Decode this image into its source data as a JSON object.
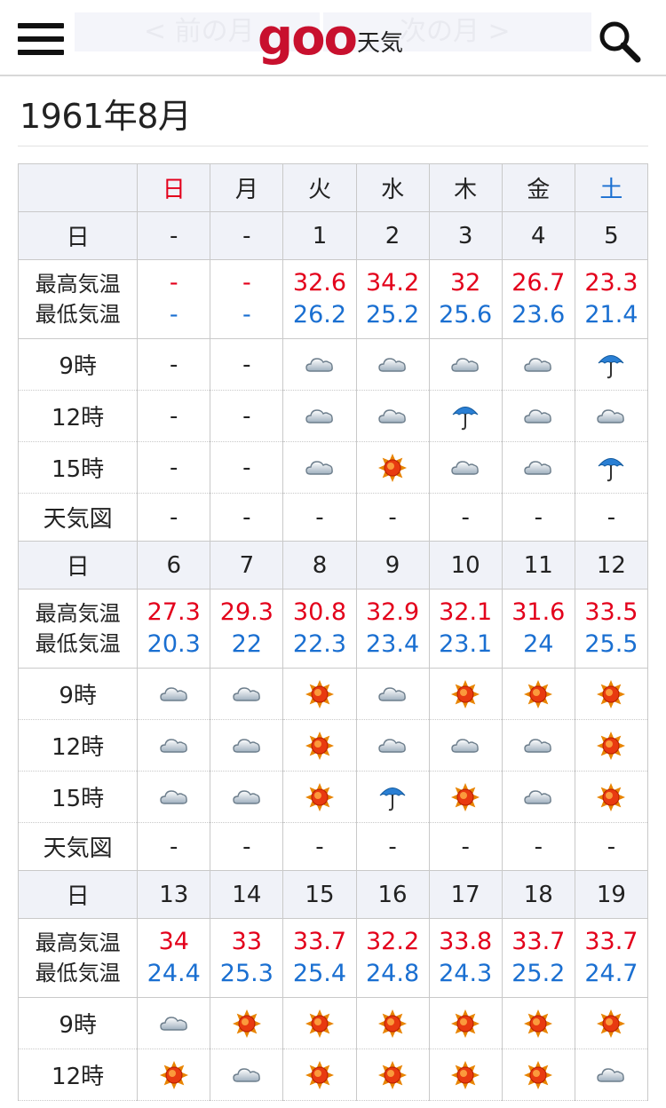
{
  "header": {
    "prev_label": "< 前の月",
    "next_label": "次の月 >",
    "logo_text": "goo",
    "logo_suffix": "天気"
  },
  "title": "1961年8月",
  "row_labels": {
    "day": "日",
    "hilo_hi": "最高気温",
    "hilo_lo": "最低気温",
    "t9": "9時",
    "t12": "12時",
    "t15": "15時",
    "map": "天気図"
  },
  "weekdays": [
    "日",
    "月",
    "火",
    "水",
    "木",
    "金",
    "土"
  ],
  "colors": {
    "high": "#e3001b",
    "low": "#1a6fd1",
    "header_bg": "#f0f2f8"
  },
  "weeks": [
    {
      "days": [
        "-",
        "-",
        "1",
        "2",
        "3",
        "4",
        "5"
      ],
      "hi": [
        "-",
        "-",
        "32.6",
        "34.2",
        "32",
        "26.7",
        "23.3"
      ],
      "lo": [
        "-",
        "-",
        "26.2",
        "25.2",
        "25.6",
        "23.6",
        "21.4"
      ],
      "t9": [
        "-",
        "-",
        "cloud-icon",
        "cloud-icon",
        "cloud-icon",
        "cloud-icon",
        "umbrella-icon"
      ],
      "t12": [
        "-",
        "-",
        "cloud-icon",
        "cloud-icon",
        "umbrella-icon",
        "cloud-icon",
        "cloud-icon"
      ],
      "t15": [
        "-",
        "-",
        "cloud-icon",
        "sun-icon",
        "cloud-icon",
        "cloud-icon",
        "umbrella-icon"
      ],
      "map": [
        "-",
        "-",
        "-",
        "-",
        "-",
        "-",
        "-"
      ]
    },
    {
      "days": [
        "6",
        "7",
        "8",
        "9",
        "10",
        "11",
        "12"
      ],
      "hi": [
        "27.3",
        "29.3",
        "30.8",
        "32.9",
        "32.1",
        "31.6",
        "33.5"
      ],
      "lo": [
        "20.3",
        "22",
        "22.3",
        "23.4",
        "23.1",
        "24",
        "25.5"
      ],
      "t9": [
        "cloud-icon",
        "cloud-icon",
        "sun-icon",
        "cloud-icon",
        "sun-icon",
        "sun-icon",
        "sun-icon"
      ],
      "t12": [
        "cloud-icon",
        "cloud-icon",
        "sun-icon",
        "cloud-icon",
        "cloud-icon",
        "cloud-icon",
        "sun-icon"
      ],
      "t15": [
        "cloud-icon",
        "cloud-icon",
        "sun-icon",
        "umbrella-icon",
        "sun-icon",
        "cloud-icon",
        "sun-icon"
      ],
      "map": [
        "-",
        "-",
        "-",
        "-",
        "-",
        "-",
        "-"
      ]
    },
    {
      "days": [
        "13",
        "14",
        "15",
        "16",
        "17",
        "18",
        "19"
      ],
      "hi": [
        "34",
        "33",
        "33.7",
        "32.2",
        "33.8",
        "33.7",
        "33.7"
      ],
      "lo": [
        "24.4",
        "25.3",
        "25.4",
        "24.8",
        "24.3",
        "25.2",
        "24.7"
      ],
      "t9": [
        "cloud-icon",
        "sun-icon",
        "sun-icon",
        "sun-icon",
        "sun-icon",
        "sun-icon",
        "sun-icon"
      ],
      "t12": [
        "sun-icon",
        "cloud-icon",
        "sun-icon",
        "sun-icon",
        "sun-icon",
        "sun-icon",
        "cloud-icon"
      ]
    }
  ]
}
